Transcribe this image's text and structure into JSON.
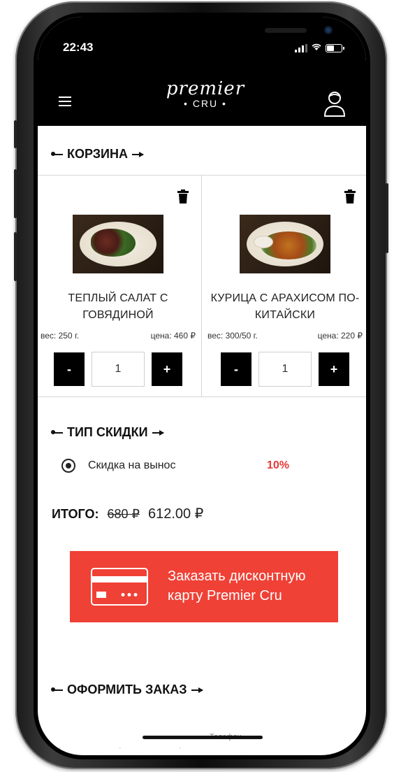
{
  "status_bar": {
    "time": "22:43"
  },
  "header": {
    "logo_script": "premier",
    "logo_sub": "• CRU •"
  },
  "cart": {
    "title": "КОРЗИНА",
    "items": [
      {
        "name": "ТЕПЛЫЙ САЛАТ С ГОВЯДИНОЙ",
        "weight": "вес: 250 г.",
        "price": "цена: 460 ₽",
        "qty": "1",
        "minus_label": "-",
        "plus_label": "+"
      },
      {
        "name": "КУРИЦА С АРАХИСОМ ПО-КИТАЙСКИ",
        "weight": "вес: 300/50 г.",
        "price": "цена: 220 ₽",
        "qty": "1",
        "minus_label": "-",
        "plus_label": "+"
      }
    ]
  },
  "discount": {
    "title": "ТИП СКИДКИ",
    "option_label": "Скидка на вынос",
    "option_value": "10%"
  },
  "total": {
    "label": "ИТОГО:",
    "old_price": "680 ₽",
    "new_price": "612.00 ₽"
  },
  "promo": {
    "line1": "Заказать дисконтную",
    "line2": "карту Premier Cru",
    "color": "#ef4136"
  },
  "checkout": {
    "title": "ОФОРМИТЬ ЗАКАЗ",
    "phone_label": "Телефон"
  }
}
